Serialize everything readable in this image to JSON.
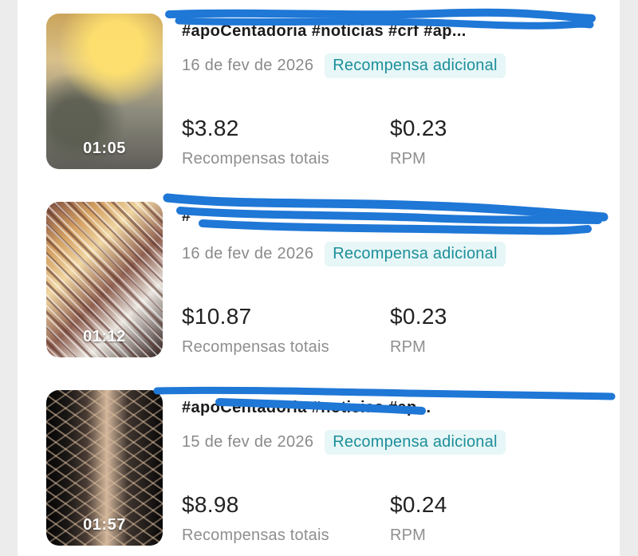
{
  "videos": [
    {
      "title": "#apoCentadoria #noticias #crf #ap...",
      "duration": "01:05",
      "date": "16 de fev de 2026",
      "badge": "Recompensa adicional",
      "total_rewards_value": "$3.82",
      "total_rewards_label": "Recompensas totais",
      "rpm_value": "$0.23",
      "rpm_label": "RPM"
    },
    {
      "title": "#",
      "duration": "01:12",
      "date": "16 de fev de 2026",
      "badge": "Recompensa adicional",
      "total_rewards_value": "$10.87",
      "total_rewards_label": "Recompensas totais",
      "rpm_value": "$0.23",
      "rpm_label": "RPM"
    },
    {
      "title": "#apoCentadoria #noticias #ap...",
      "duration": "01:57",
      "date": "15 de fev de 2026",
      "badge": "Recompensa adicional",
      "total_rewards_value": "$8.98",
      "total_rewards_label": "Recompensas totais",
      "rpm_value": "$0.24",
      "rpm_label": "RPM"
    }
  ],
  "colors": {
    "badge_text": "#1c8f9b",
    "badge_bg": "#e7f6f6",
    "redaction": "#1f77d6"
  }
}
